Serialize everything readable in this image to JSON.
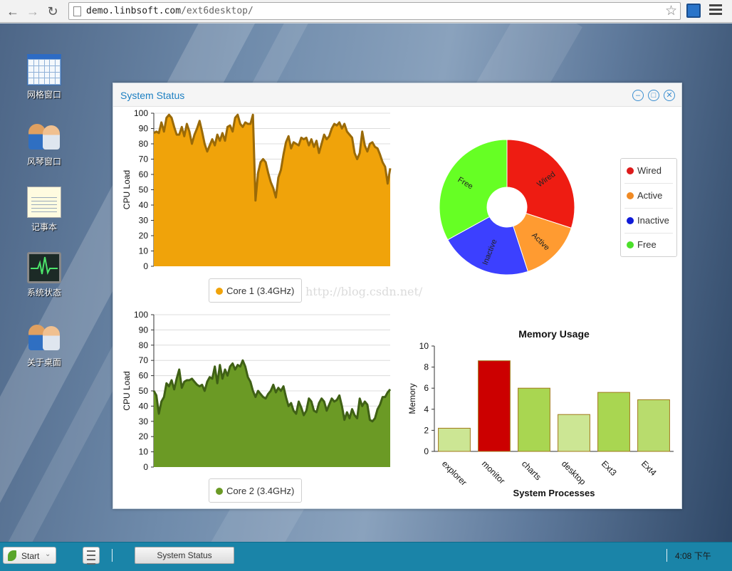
{
  "browser": {
    "url_host": "demo.linbsoft.com",
    "url_path": "/ext6desktop/"
  },
  "desktop_icons": [
    {
      "label": "网格窗口",
      "icon": "grid-window-icon"
    },
    {
      "label": "风琴窗口",
      "icon": "accordion-window-icon"
    },
    {
      "label": "记事本",
      "icon": "notepad-icon"
    },
    {
      "label": "系统状态",
      "icon": "system-status-icon"
    },
    {
      "label": "关于桌面",
      "icon": "about-desktop-icon"
    }
  ],
  "window": {
    "title": "System Status",
    "tools": [
      "minimize-icon",
      "maximize-icon",
      "close-icon"
    ]
  },
  "watermark": "http://blog.csdn.net/",
  "chart_data": [
    {
      "type": "area",
      "ylabel": "CPU Load",
      "ylim": [
        0,
        100
      ],
      "yticks": [
        0,
        10,
        20,
        30,
        40,
        50,
        60,
        70,
        80,
        90,
        100
      ],
      "grid": true,
      "legend": "bottom",
      "color": "#f0a30a",
      "line_color": "#9a6a08",
      "series": [
        {
          "name": "Core 1 (3.4GHz)",
          "values": [
            87,
            88,
            87,
            94,
            88,
            97,
            99,
            97,
            91,
            86,
            86,
            91,
            85,
            93,
            88,
            80,
            86,
            90,
            95,
            88,
            80,
            75,
            79,
            83,
            79,
            86,
            82,
            87,
            82,
            91,
            92,
            88,
            97,
            99,
            93,
            91,
            94,
            93,
            93,
            99,
            43,
            61,
            68,
            70,
            68,
            61,
            55,
            51,
            45,
            58,
            63,
            73,
            81,
            85,
            77,
            81,
            80,
            79,
            84,
            83,
            84,
            79,
            83,
            78,
            82,
            74,
            80,
            86,
            83,
            85,
            90,
            93,
            92,
            94,
            90,
            93,
            88,
            86,
            84,
            74,
            70,
            74,
            88,
            79,
            75,
            80,
            81,
            78,
            77,
            73,
            68,
            65,
            54,
            64
          ]
        }
      ]
    },
    {
      "type": "area",
      "ylabel": "CPU Load",
      "ylim": [
        0,
        100
      ],
      "yticks": [
        0,
        10,
        20,
        30,
        40,
        50,
        60,
        70,
        80,
        90,
        100
      ],
      "grid": true,
      "legend": "bottom",
      "color": "#6b9a25",
      "line_color": "#3f6015",
      "series": [
        {
          "name": "Core 2 (3.4GHz)",
          "values": [
            50,
            47,
            35,
            43,
            46,
            55,
            53,
            57,
            51,
            58,
            64,
            52,
            56,
            57,
            57,
            58,
            56,
            54,
            53,
            54,
            50,
            56,
            59,
            58,
            66,
            55,
            67,
            58,
            64,
            60,
            66,
            68,
            64,
            67,
            66,
            70,
            66,
            59,
            56,
            50,
            46,
            50,
            48,
            46,
            45,
            48,
            50,
            54,
            49,
            52,
            50,
            53,
            46,
            40,
            42,
            37,
            35,
            43,
            39,
            34,
            37,
            45,
            43,
            37,
            36,
            42,
            45,
            43,
            37,
            41,
            45,
            43,
            44,
            47,
            40,
            31,
            36,
            32,
            38,
            34,
            32,
            45,
            40,
            43,
            41,
            31,
            30,
            32,
            38,
            41,
            46,
            46,
            49,
            51
          ]
        }
      ]
    },
    {
      "type": "pie",
      "donut": true,
      "categories": [
        "Wired",
        "Active",
        "Inactive",
        "Free"
      ],
      "values": [
        30,
        15,
        22,
        33
      ],
      "colors": [
        "#ee1c12",
        "#ff9b31",
        "#3c40ff",
        "#66ff24"
      ],
      "legend": "right"
    },
    {
      "type": "bar",
      "title": "Memory Usage",
      "xlabel": "System Processes",
      "ylabel": "Memory",
      "categories": [
        "explorer",
        "monitor",
        "charts",
        "desktop",
        "Ext3",
        "Ext4"
      ],
      "values": [
        2.2,
        8.6,
        6.0,
        3.5,
        5.6,
        4.9
      ],
      "colors": [
        "#cce694",
        "#cc0000",
        "#a9d651",
        "#cce694",
        "#a9d651",
        "#b8dc6d"
      ],
      "ylim": [
        0,
        10
      ],
      "yticks": [
        0,
        2,
        4,
        6,
        8,
        10
      ],
      "grid": false
    }
  ],
  "taskbar": {
    "start_label": "Start",
    "task_label": "System Status",
    "clock": "4:08 下午"
  }
}
